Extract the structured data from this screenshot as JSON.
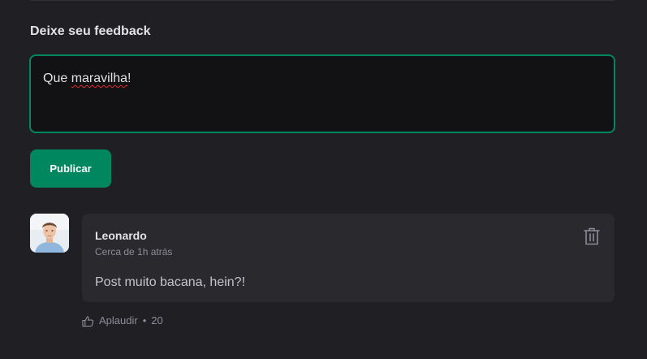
{
  "feedback": {
    "title": "Deixe seu feedback",
    "input_prefix": "Que ",
    "input_misspelled": "maravilha",
    "input_suffix": "!",
    "accent_color": "#00875f"
  },
  "publish": {
    "label": "Publicar"
  },
  "comment": {
    "author": "Leonardo",
    "time": "Cerca de 1h atrás",
    "content": "Post muito bacana, hein?!",
    "delete_icon": "trash-icon",
    "avatar": "user-avatar-photo"
  },
  "applaud": {
    "icon": "thumbs-up-icon",
    "label": "Aplaudir",
    "separator": "•",
    "count": "20"
  }
}
